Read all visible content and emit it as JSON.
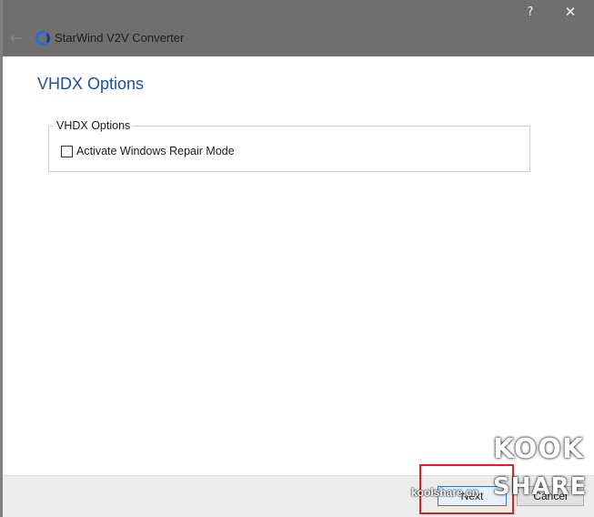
{
  "window": {
    "title": "StarWind V2V Converter",
    "help_label": "?",
    "close_label": "✕",
    "back_label": "←"
  },
  "page": {
    "title": "VHDX Options"
  },
  "group": {
    "legend": "VHDX Options",
    "checkbox_label": "Activate Windows Repair Mode",
    "checkbox_checked": false
  },
  "footer": {
    "next_label": "Next",
    "cancel_label": "Cancel"
  },
  "watermark": {
    "logo_line1": "KOOK",
    "logo_line2": "SHARE",
    "url": "koolshare.cn"
  },
  "colors": {
    "titlebar": "#6f6f6f",
    "accent": "#1f4f9c",
    "highlight": "#e02020"
  }
}
